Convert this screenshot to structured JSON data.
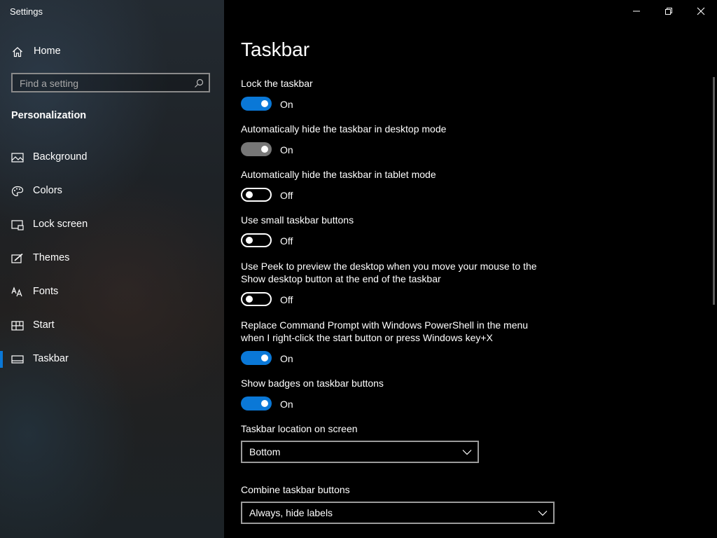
{
  "window": {
    "title": "Settings"
  },
  "sidebar": {
    "home_label": "Home",
    "search_placeholder": "Find a setting",
    "section_title": "Personalization",
    "items": [
      {
        "label": "Background",
        "icon": "picture-icon"
      },
      {
        "label": "Colors",
        "icon": "palette-icon"
      },
      {
        "label": "Lock screen",
        "icon": "lock-screen-icon"
      },
      {
        "label": "Themes",
        "icon": "themes-icon"
      },
      {
        "label": "Fonts",
        "icon": "fonts-icon"
      },
      {
        "label": "Start",
        "icon": "start-icon"
      },
      {
        "label": "Taskbar",
        "icon": "taskbar-icon",
        "selected": true
      }
    ]
  },
  "main": {
    "title": "Taskbar",
    "settings": [
      {
        "label": "Lock the taskbar",
        "state": "On"
      },
      {
        "label": "Automatically hide the taskbar in desktop mode",
        "state": "On"
      },
      {
        "label": "Automatically hide the taskbar in tablet mode",
        "state": "Off"
      },
      {
        "label": "Use small taskbar buttons",
        "state": "Off"
      },
      {
        "label": "Use Peek to preview the desktop when you move your mouse to the Show desktop button at the end of the taskbar",
        "state": "Off"
      },
      {
        "label": "Replace Command Prompt with Windows PowerShell in the menu when I right-click the start button or press Windows key+X",
        "state": "On"
      },
      {
        "label": "Show badges on taskbar buttons",
        "state": "On"
      }
    ],
    "location": {
      "label": "Taskbar location on screen",
      "value": "Bottom"
    },
    "combine": {
      "label": "Combine taskbar buttons",
      "value": "Always, hide labels"
    }
  },
  "colors": {
    "accent": "#0a78d7",
    "background": "#000000",
    "toggle_hover": "#777777"
  }
}
